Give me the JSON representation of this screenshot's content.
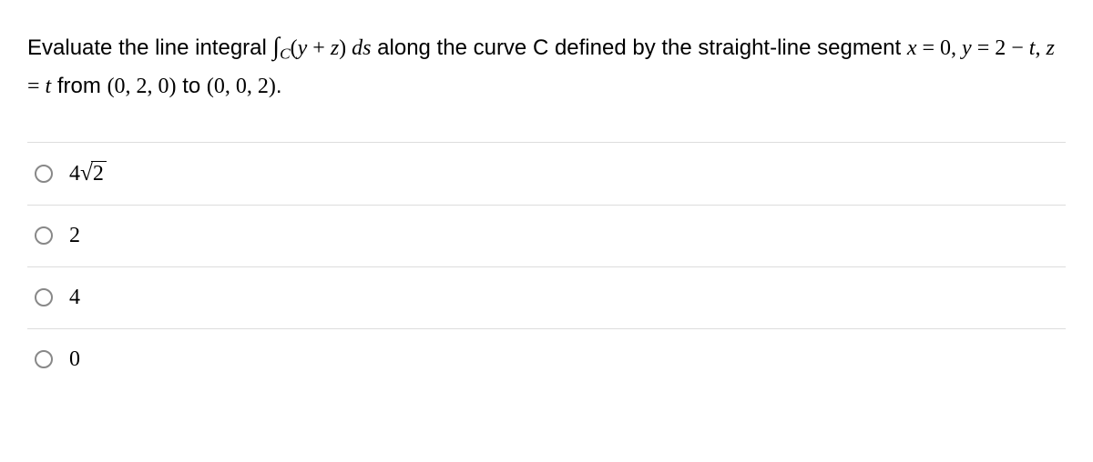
{
  "question": {
    "part1": "Evaluate the line integral ",
    "integral_sym": "∫",
    "integral_sub": "C",
    "integrand_open": "(",
    "integrand_y": "y",
    "integrand_plus": " + ",
    "integrand_z": "z",
    "integrand_close": ") ",
    "ds_d": "d",
    "ds_s": "s",
    "part2": " along the curve C defined by the straight-line segment ",
    "eq_x": "x",
    "eq_eq1": " = 0, ",
    "eq_y": "y",
    "eq_eq2": " = 2 − ",
    "eq_t1": "t",
    "eq_comma": ", ",
    "eq_z": "z",
    "eq_eq3": " = ",
    "eq_t2": "t",
    "part3": " from ",
    "pt1": "(0, 2, 0)",
    "part4": " to ",
    "pt2": "(0, 0, 2)",
    "period": "."
  },
  "options": [
    {
      "prefix": "4",
      "sqrt": "2"
    },
    {
      "text": "2"
    },
    {
      "text": "4"
    },
    {
      "text": "0"
    }
  ]
}
